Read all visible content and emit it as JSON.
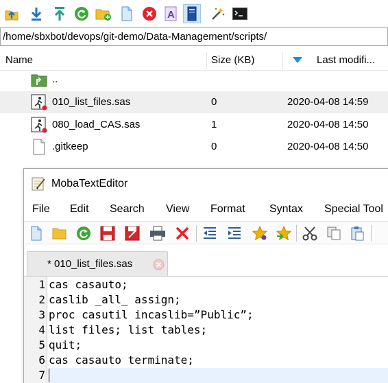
{
  "toolbar": {
    "icons": [
      "upload-icon",
      "download-icon",
      "upload-file-icon",
      "refresh-icon",
      "new-folder-icon",
      "new-file-icon",
      "delete-icon",
      "rename-icon",
      "open-editor-icon",
      "magic-wand-icon",
      "terminal-icon"
    ]
  },
  "path": "/home/sbxbot/devops/git-demo/Data-Management/scripts/",
  "columns": {
    "name": "Name",
    "size": "Size (KB)",
    "modified": "Last modifi..."
  },
  "files": [
    {
      "name": "..",
      "size": "",
      "modified": "",
      "icon": "parent-folder-icon"
    },
    {
      "name": "010_list_files.sas",
      "size": "0",
      "modified": "2020-04-08 14:59",
      "icon": "sas-file-icon"
    },
    {
      "name": "080_load_CAS.sas",
      "size": "1",
      "modified": "2020-04-08 14:50",
      "icon": "sas-file-icon"
    },
    {
      "name": ".gitkeep",
      "size": "0",
      "modified": "2020-04-08 14:50",
      "icon": "blank-file-icon"
    }
  ],
  "editor": {
    "title": "MobaTextEditor",
    "menu": [
      "File",
      "Edit",
      "Search",
      "View",
      "Format",
      "Syntax",
      "Special Tool"
    ],
    "tab_label": "* 010_list_files.sas",
    "lines": [
      "cas casauto;",
      "caslib _all_ assign;",
      "proc casutil incaslib=”Public”;",
      "list files; list tables;",
      "quit;",
      "cas casauto terminate;",
      ""
    ]
  },
  "colors": {
    "selection": "#efefef",
    "active_button": "#cfe4f7",
    "current_line": "#e8f2fe",
    "delete_red": "#e8202a",
    "refresh_green": "#3aa935",
    "folder_yellow": "#f2c134"
  }
}
